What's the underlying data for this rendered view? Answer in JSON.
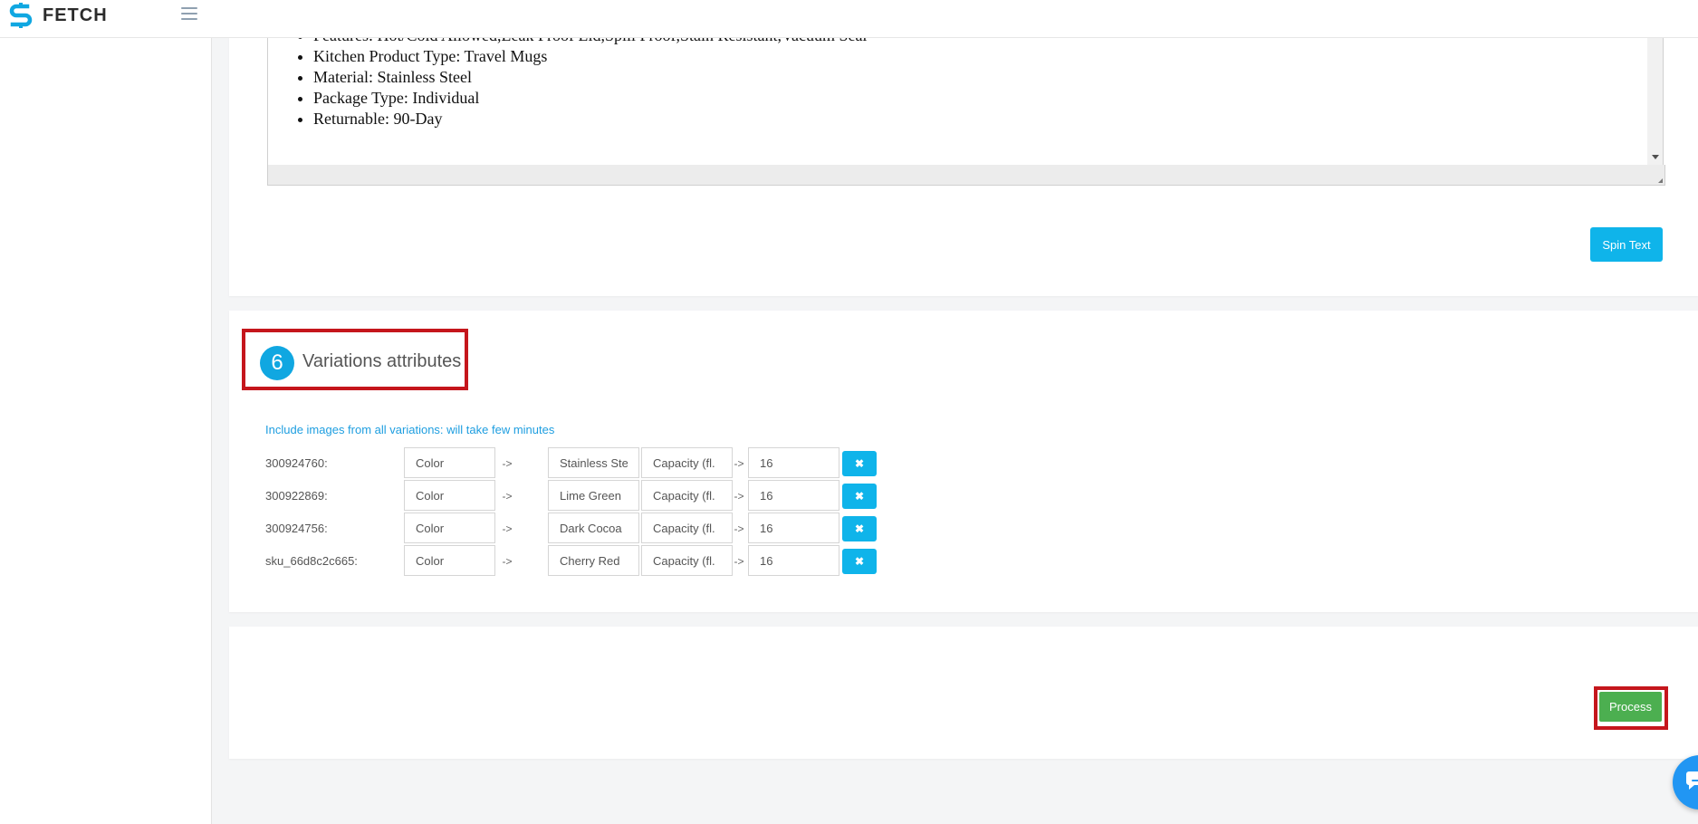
{
  "app": {
    "brand_name": "FETCH",
    "brand_color": "#10a7e1"
  },
  "description": {
    "items": [
      "Features: Hot/Cold Allowed,Leak Proof Lid,Spill Proof,Stain Resistant,Vacuum Seal",
      "Kitchen Product Type: Travel Mugs",
      "Material: Stainless Steel",
      "Package Type: Individual",
      "Returnable: 90-Day"
    ],
    "spin_button_label": "Spin Text"
  },
  "variations": {
    "step_number": "6",
    "title": "Variations attributes",
    "include_images_link": "Include images from all variations: will take few minutes",
    "arrow_symbol": "->",
    "rows": [
      {
        "sku": "300924760:",
        "attr1": "Color",
        "val1": "Stainless Ste",
        "attr2": "Capacity (fl.",
        "val2": "16"
      },
      {
        "sku": "300922869:",
        "attr1": "Color",
        "val1": "Lime Green",
        "attr2": "Capacity (fl.",
        "val2": "16"
      },
      {
        "sku": "300924756:",
        "attr1": "Color",
        "val1": "Dark Cocoa",
        "attr2": "Capacity (fl.",
        "val2": "16"
      },
      {
        "sku": "sku_66d8c2c665:",
        "attr1": "Color",
        "val1": "Cherry Red",
        "attr2": "Capacity (fl.",
        "val2": "16"
      }
    ],
    "delete_icon": "close-icon"
  },
  "actions": {
    "process_label": "Process",
    "process_color": "#4caf50",
    "accent_color": "#0fb4ea"
  },
  "chat": {
    "icon": "chat-bubble-icon"
  }
}
